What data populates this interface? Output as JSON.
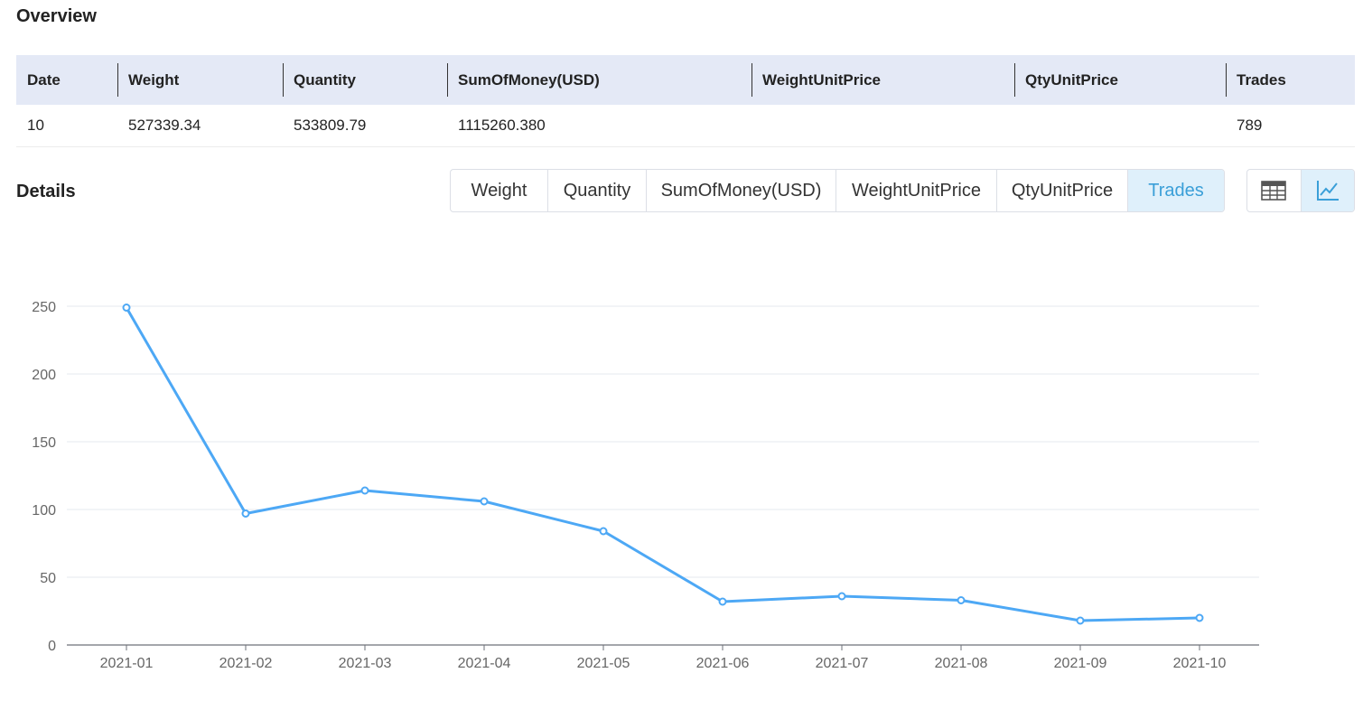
{
  "overview": {
    "title": "Overview",
    "headers": [
      "Date",
      "Weight",
      "Quantity",
      "SumOfMoney(USD)",
      "WeightUnitPrice",
      "QtyUnitPrice",
      "Trades"
    ],
    "row": [
      "10",
      "527339.34",
      "533809.79",
      "1115260.380",
      "",
      "",
      "789"
    ]
  },
  "details": {
    "title": "Details",
    "tabs": [
      "Weight",
      "Quantity",
      "SumOfMoney(USD)",
      "WeightUnitPrice",
      "QtyUnitPrice",
      "Trades"
    ],
    "active_tab": "Trades",
    "view_buttons": [
      {
        "icon": "table-icon",
        "active": false
      },
      {
        "icon": "line-chart-icon",
        "active": true
      }
    ]
  },
  "colors": {
    "accent": "#3a9fd8",
    "line": "#4da8f5",
    "header_bg": "#e4e9f6",
    "tab_active_bg": "#dff0fb"
  },
  "chart_data": {
    "type": "line",
    "title": "",
    "xlabel": "",
    "ylabel": "",
    "categories": [
      "2021-01",
      "2021-02",
      "2021-03",
      "2021-04",
      "2021-05",
      "2021-06",
      "2021-07",
      "2021-08",
      "2021-09",
      "2021-10"
    ],
    "series": [
      {
        "values": [
          249,
          97,
          114,
          106,
          84,
          32,
          36,
          33,
          18,
          20
        ]
      }
    ],
    "y_ticks": [
      0,
      50,
      100,
      150,
      200,
      250
    ],
    "ylim": [
      0,
      250
    ],
    "grid": true,
    "legend": "none"
  }
}
